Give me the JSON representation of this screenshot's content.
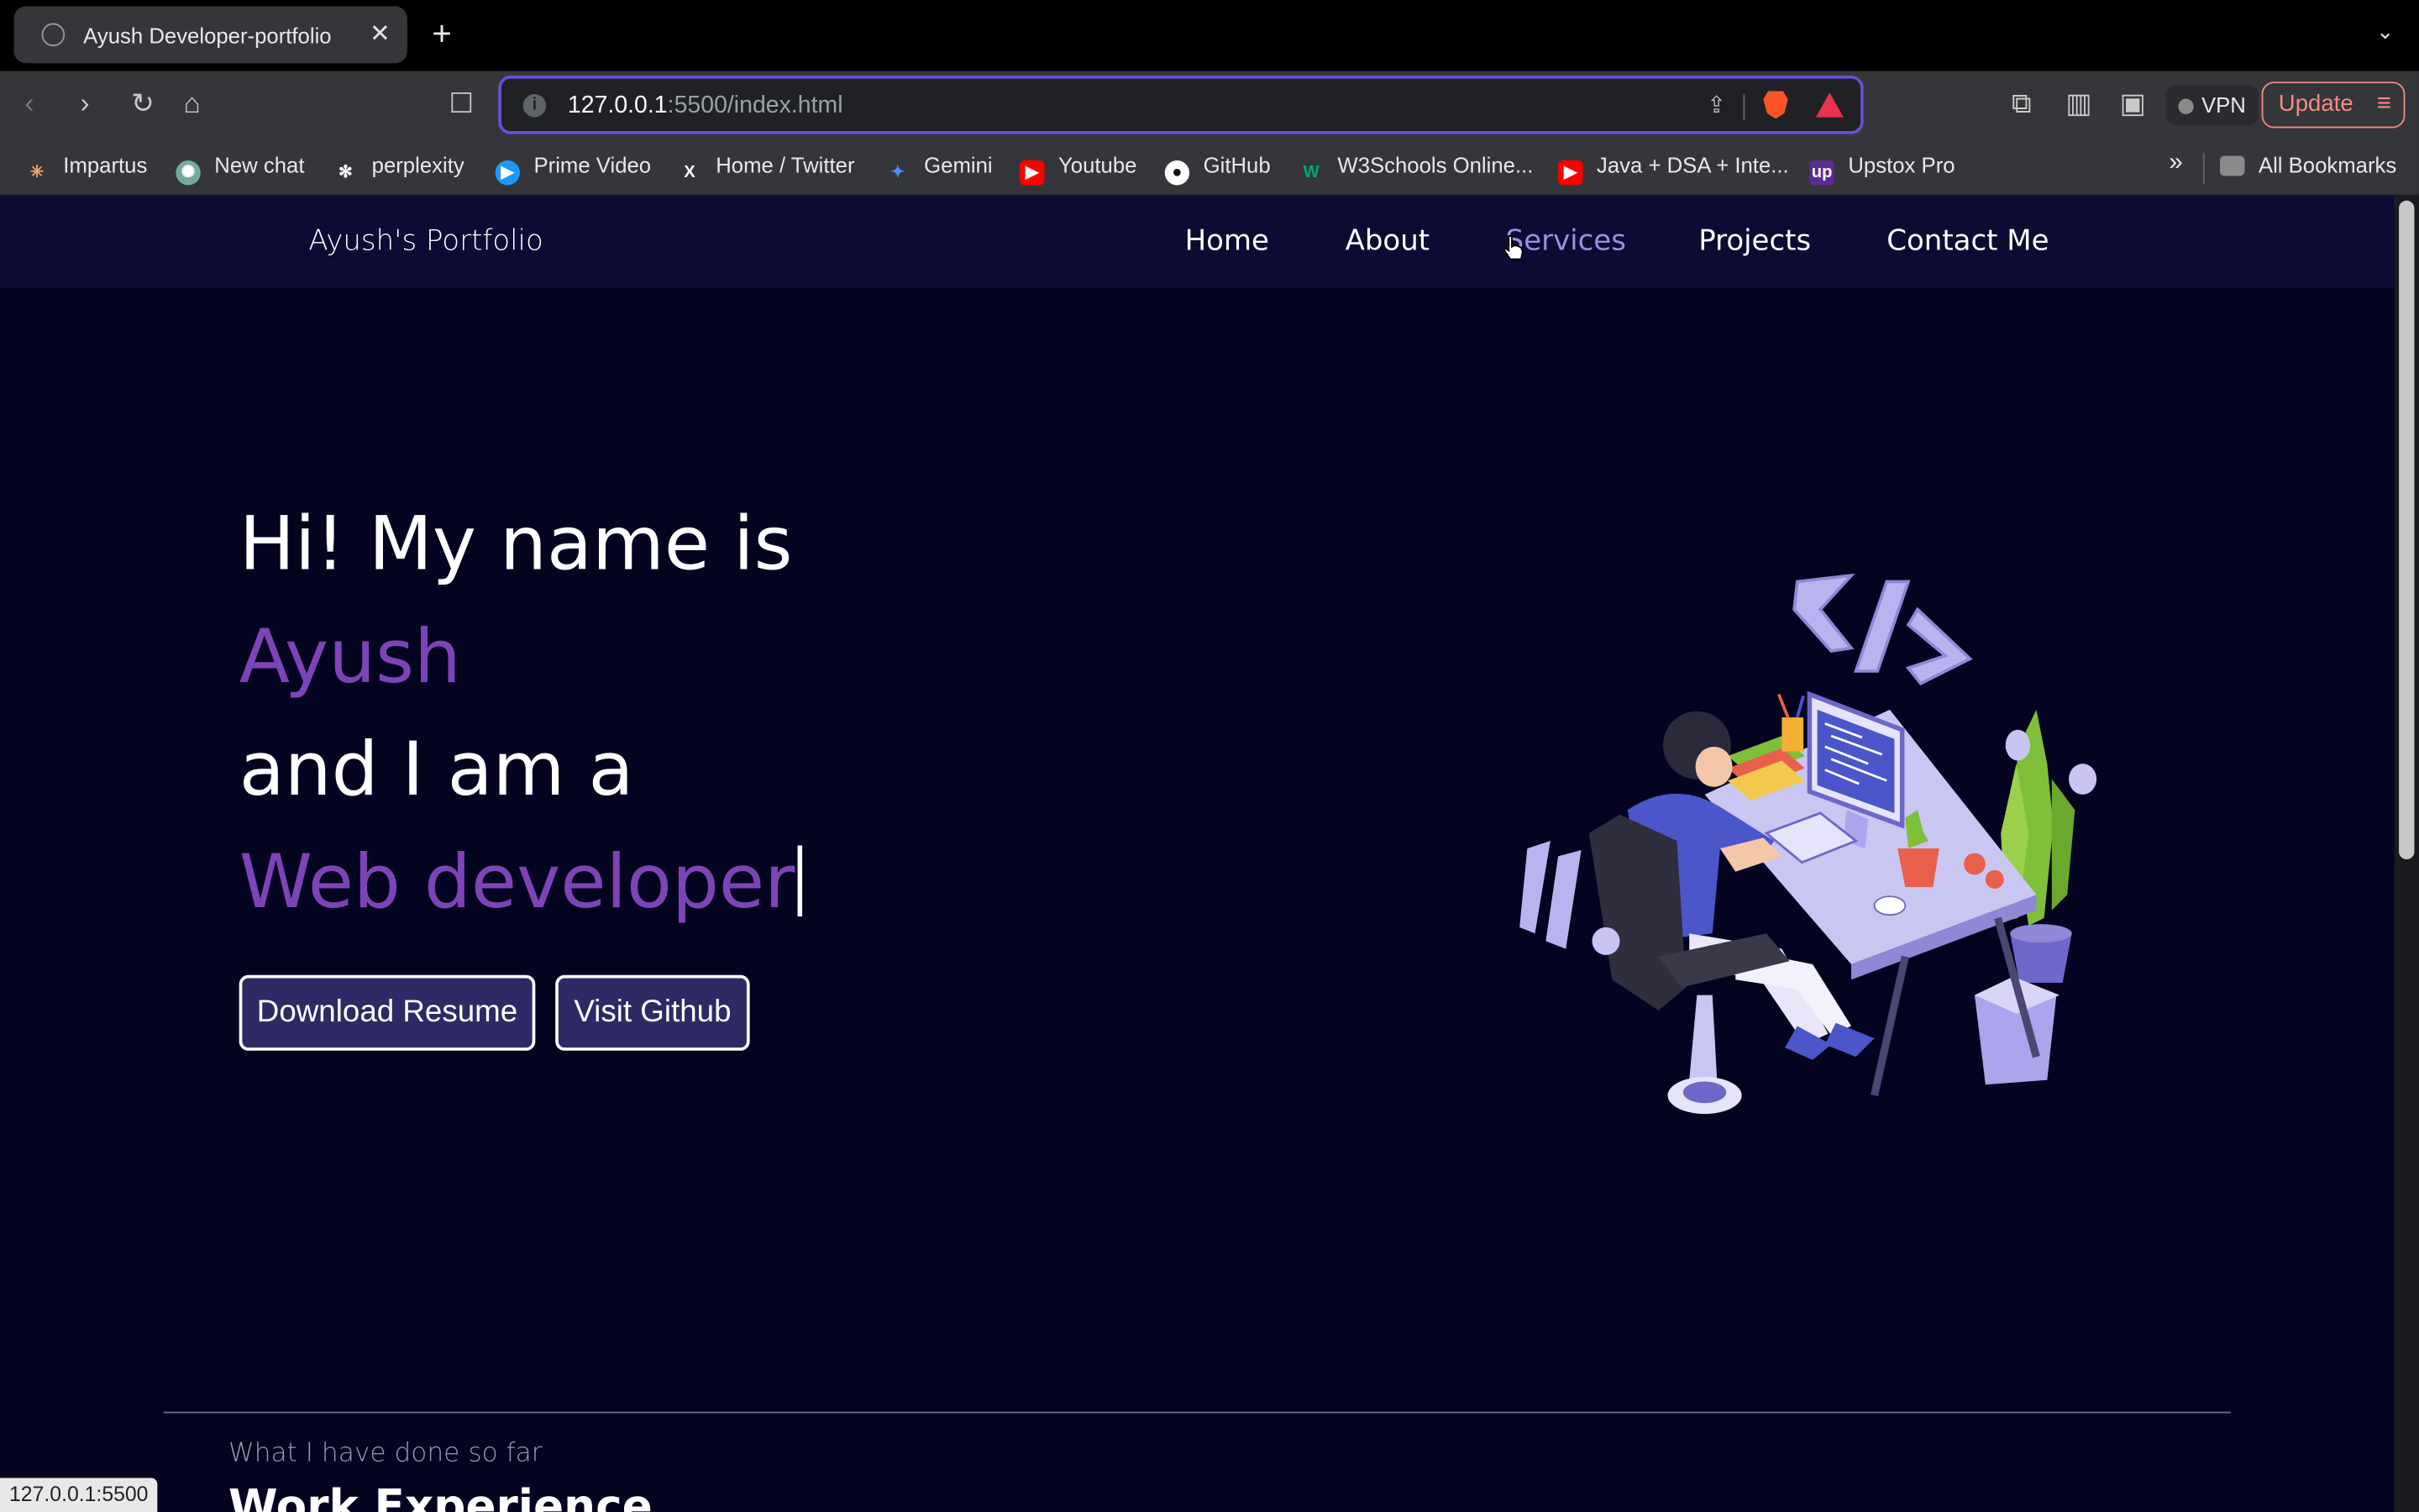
{
  "browser": {
    "tab_title": "Ayush Developer-portfolio",
    "tab_close": "✕",
    "new_tab": "+",
    "url_host": "127.0.0.1",
    "url_rest": ":5500/index.html",
    "vpn_label": "VPN",
    "update_label": "Update",
    "bookmarks": [
      {
        "label": "Impartus",
        "icon": "impartus-icon",
        "color": "#f4a261"
      },
      {
        "label": "New chat",
        "icon": "openai-icon",
        "color": "#74aa9c"
      },
      {
        "label": "perplexity",
        "icon": "perplexity-icon",
        "color": "#ffffff"
      },
      {
        "label": "Prime Video",
        "icon": "prime-video-icon",
        "color": "#1a98ff"
      },
      {
        "label": "Home / Twitter",
        "icon": "x-icon",
        "color": "#ffffff"
      },
      {
        "label": "Gemini",
        "icon": "gemini-icon",
        "color": "#4c8df6"
      },
      {
        "label": "Youtube",
        "icon": "youtube-icon",
        "color": "#ff0000"
      },
      {
        "label": "GitHub",
        "icon": "github-icon",
        "color": "#ffffff"
      },
      {
        "label": "W3Schools Online...",
        "icon": "w3schools-icon",
        "color": "#04aa6d"
      },
      {
        "label": "Java + DSA + Inte...",
        "icon": "youtube-icon",
        "color": "#ff0000"
      },
      {
        "label": "Upstox Pro",
        "icon": "upstox-icon",
        "color": "#5a2d91"
      }
    ],
    "bookmarks_more": "»",
    "all_bookmarks": "All Bookmarks",
    "status_url": "127.0.0.1:5500"
  },
  "nav": {
    "brand": "Ayush's Portfolio",
    "links": [
      "Home",
      "About",
      "Services",
      "Projects",
      "Contact Me"
    ],
    "hovered": "Services"
  },
  "hero": {
    "line1": "Hi! My name is",
    "name": "Ayush",
    "line3": "and I am a",
    "role": "Web developer",
    "buttons": {
      "resume": "Download Resume",
      "github": "Visit Github"
    }
  },
  "experience": {
    "subtitle": "What I have done so far",
    "title": "Work Experience"
  },
  "colors": {
    "page_bg": "#050420",
    "navbar_bg": "#0c0b33",
    "accent_purple": "#7d44b8",
    "button_bg": "#2e2a66"
  }
}
